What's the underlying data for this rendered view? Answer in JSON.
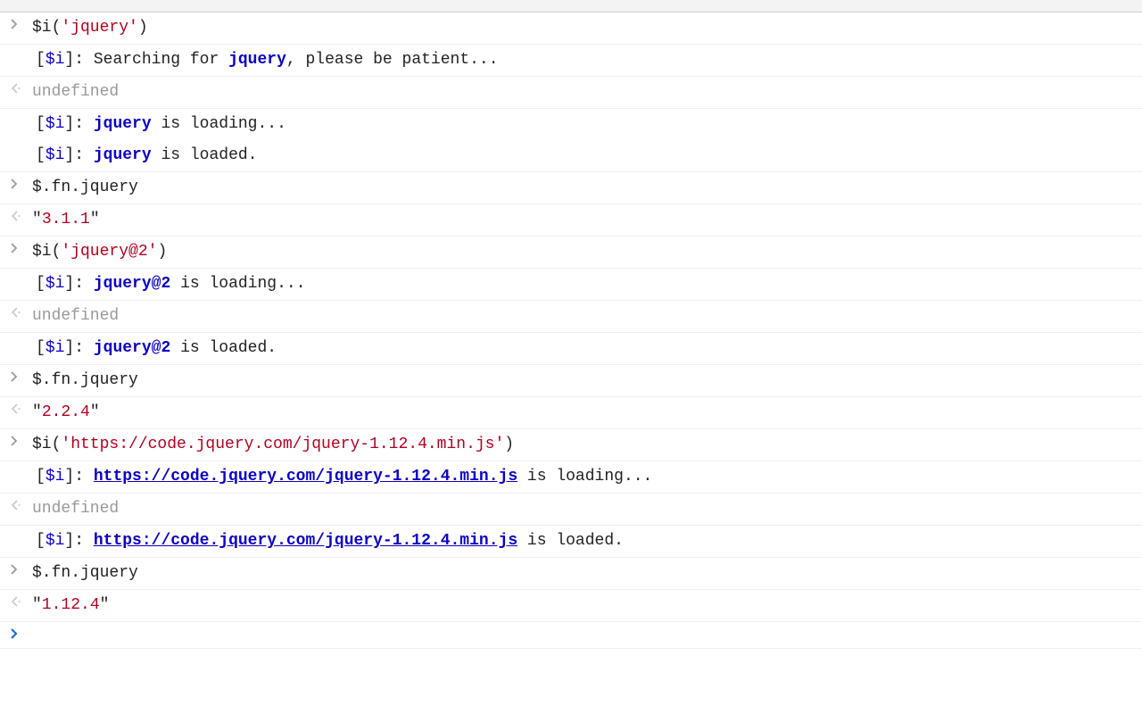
{
  "rows": [
    {
      "type": "input",
      "segments": [
        {
          "t": "$i(",
          "c": "c-dark"
        },
        {
          "t": "'jquery'",
          "c": "c-red"
        },
        {
          "t": ")",
          "c": "c-dark"
        }
      ]
    },
    {
      "type": "info",
      "segments": [
        {
          "t": "[",
          "c": "c-dark"
        },
        {
          "t": "$i",
          "c": "c-tag"
        },
        {
          "t": "]",
          "c": "c-dark"
        },
        {
          "t": ": ",
          "c": "c-dark"
        },
        {
          "t": "Searching for ",
          "c": "c-dark"
        },
        {
          "t": "jquery",
          "c": "c-bold-blue"
        },
        {
          "t": ", please be patient...",
          "c": "c-dark"
        }
      ]
    },
    {
      "type": "output",
      "segments": [
        {
          "t": "undefined",
          "c": "c-gray"
        }
      ]
    },
    {
      "type": "info",
      "segments": [
        {
          "t": "[",
          "c": "c-dark"
        },
        {
          "t": "$i",
          "c": "c-tag"
        },
        {
          "t": "]",
          "c": "c-dark"
        },
        {
          "t": ": ",
          "c": "c-dark"
        },
        {
          "t": "jquery",
          "c": "c-bold-blue"
        },
        {
          "t": " is loading...",
          "c": "c-dark"
        }
      ],
      "no_border": true
    },
    {
      "type": "info",
      "segments": [
        {
          "t": "[",
          "c": "c-dark"
        },
        {
          "t": "$i",
          "c": "c-tag"
        },
        {
          "t": "]",
          "c": "c-dark"
        },
        {
          "t": ": ",
          "c": "c-dark"
        },
        {
          "t": "jquery",
          "c": "c-bold-blue"
        },
        {
          "t": " is loaded.",
          "c": "c-dark"
        }
      ]
    },
    {
      "type": "input",
      "segments": [
        {
          "t": "$.fn.jquery",
          "c": "c-dark"
        }
      ]
    },
    {
      "type": "output",
      "segments": [
        {
          "t": "\"",
          "c": "c-dark"
        },
        {
          "t": "3.1.1",
          "c": "c-red"
        },
        {
          "t": "\"",
          "c": "c-dark"
        }
      ]
    },
    {
      "type": "input",
      "segments": [
        {
          "t": "$i(",
          "c": "c-dark"
        },
        {
          "t": "'jquery@2'",
          "c": "c-red"
        },
        {
          "t": ")",
          "c": "c-dark"
        }
      ]
    },
    {
      "type": "info",
      "segments": [
        {
          "t": "[",
          "c": "c-dark"
        },
        {
          "t": "$i",
          "c": "c-tag"
        },
        {
          "t": "]",
          "c": "c-dark"
        },
        {
          "t": ": ",
          "c": "c-dark"
        },
        {
          "t": "jquery@2",
          "c": "c-bold-blue"
        },
        {
          "t": " is loading...",
          "c": "c-dark"
        }
      ]
    },
    {
      "type": "output",
      "segments": [
        {
          "t": "undefined",
          "c": "c-gray"
        }
      ]
    },
    {
      "type": "info",
      "segments": [
        {
          "t": "[",
          "c": "c-dark"
        },
        {
          "t": "$i",
          "c": "c-tag"
        },
        {
          "t": "]",
          "c": "c-dark"
        },
        {
          "t": ": ",
          "c": "c-dark"
        },
        {
          "t": "jquery@2",
          "c": "c-bold-blue"
        },
        {
          "t": " is loaded.",
          "c": "c-dark"
        }
      ]
    },
    {
      "type": "input",
      "segments": [
        {
          "t": "$.fn.jquery",
          "c": "c-dark"
        }
      ]
    },
    {
      "type": "output",
      "segments": [
        {
          "t": "\"",
          "c": "c-dark"
        },
        {
          "t": "2.2.4",
          "c": "c-red"
        },
        {
          "t": "\"",
          "c": "c-dark"
        }
      ]
    },
    {
      "type": "input",
      "segments": [
        {
          "t": "$i(",
          "c": "c-dark"
        },
        {
          "t": "'https://code.jquery.com/jquery-1.12.4.min.js'",
          "c": "c-red"
        },
        {
          "t": ")",
          "c": "c-dark"
        }
      ]
    },
    {
      "type": "info",
      "segments": [
        {
          "t": "[",
          "c": "c-dark"
        },
        {
          "t": "$i",
          "c": "c-tag"
        },
        {
          "t": "]",
          "c": "c-dark"
        },
        {
          "t": ": ",
          "c": "c-dark"
        },
        {
          "t": "https://code.jquery.com/jquery-1.12.4.min.js",
          "c": "c-link"
        },
        {
          "t": " is loading...",
          "c": "c-dark"
        }
      ]
    },
    {
      "type": "output",
      "segments": [
        {
          "t": "undefined",
          "c": "c-gray"
        }
      ]
    },
    {
      "type": "info",
      "segments": [
        {
          "t": "[",
          "c": "c-dark"
        },
        {
          "t": "$i",
          "c": "c-tag"
        },
        {
          "t": "]",
          "c": "c-dark"
        },
        {
          "t": ": ",
          "c": "c-dark"
        },
        {
          "t": "https://code.jquery.com/jquery-1.12.4.min.js",
          "c": "c-link"
        },
        {
          "t": " is loaded.",
          "c": "c-dark"
        }
      ]
    },
    {
      "type": "input",
      "segments": [
        {
          "t": "$.fn.jquery",
          "c": "c-dark"
        }
      ]
    },
    {
      "type": "output",
      "segments": [
        {
          "t": "\"",
          "c": "c-dark"
        },
        {
          "t": "1.12.4",
          "c": "c-red"
        },
        {
          "t": "\"",
          "c": "c-dark"
        }
      ]
    },
    {
      "type": "prompt",
      "segments": []
    }
  ]
}
